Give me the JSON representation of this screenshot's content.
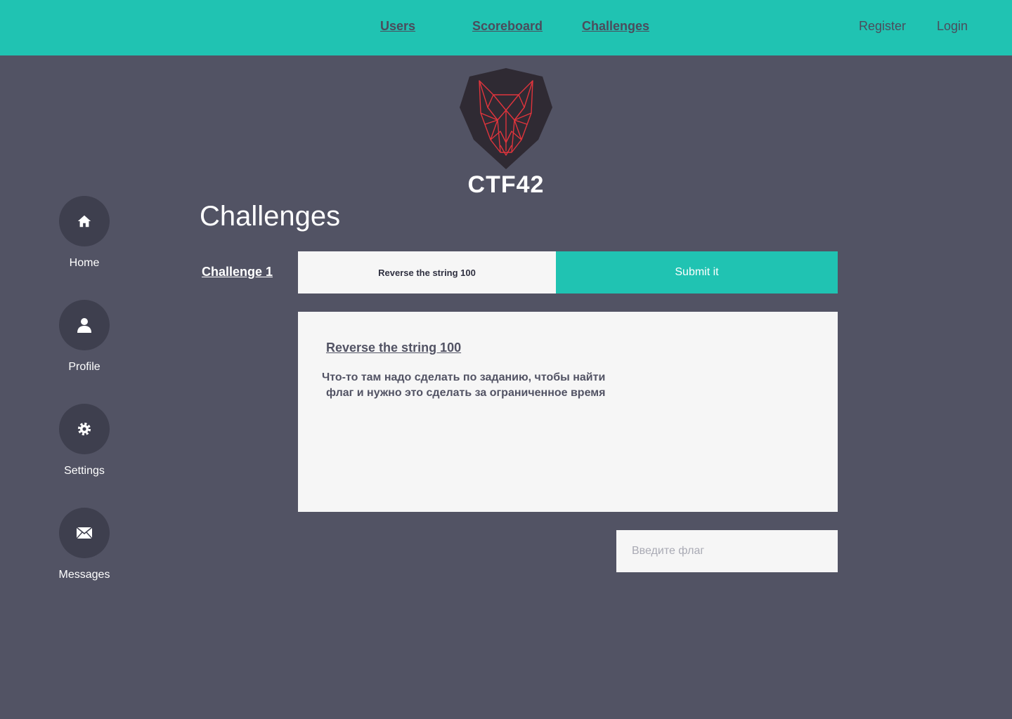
{
  "nav": {
    "users": "Users",
    "scoreboard": "Scoreboard",
    "challenges": "Challenges",
    "register": "Register",
    "login": "Login"
  },
  "brand": {
    "name": "CTF42",
    "logo_icon": "wolf-shield-icon"
  },
  "sidebar": {
    "items": [
      {
        "label": "Home",
        "icon": "home-icon"
      },
      {
        "label": "Profile",
        "icon": "user-icon"
      },
      {
        "label": "Settings",
        "icon": "gear-icon"
      },
      {
        "label": "Messages",
        "icon": "envelope-icon"
      }
    ]
  },
  "main": {
    "title": "Challenges",
    "challenge_link": "Challenge 1",
    "challenge_tab": "Reverse the string 100",
    "submit_label": "Submit it",
    "card": {
      "title": "Reverse the string 100",
      "description_line1": "Что-то там надо сделать по заданию, чтобы найти",
      "description_line2": "флаг и нужно это сделать за ограниченное время"
    },
    "flag_input": {
      "placeholder": "Введите флаг",
      "value": ""
    }
  },
  "colors": {
    "background": "#525364",
    "accent": "#20c3b2",
    "card": "#f6f6f6",
    "nav_text": "#4b4c5c",
    "side_circle": "#3e3f4e",
    "logo_shield": "#2f2a33",
    "logo_lines": "#e0343c"
  }
}
